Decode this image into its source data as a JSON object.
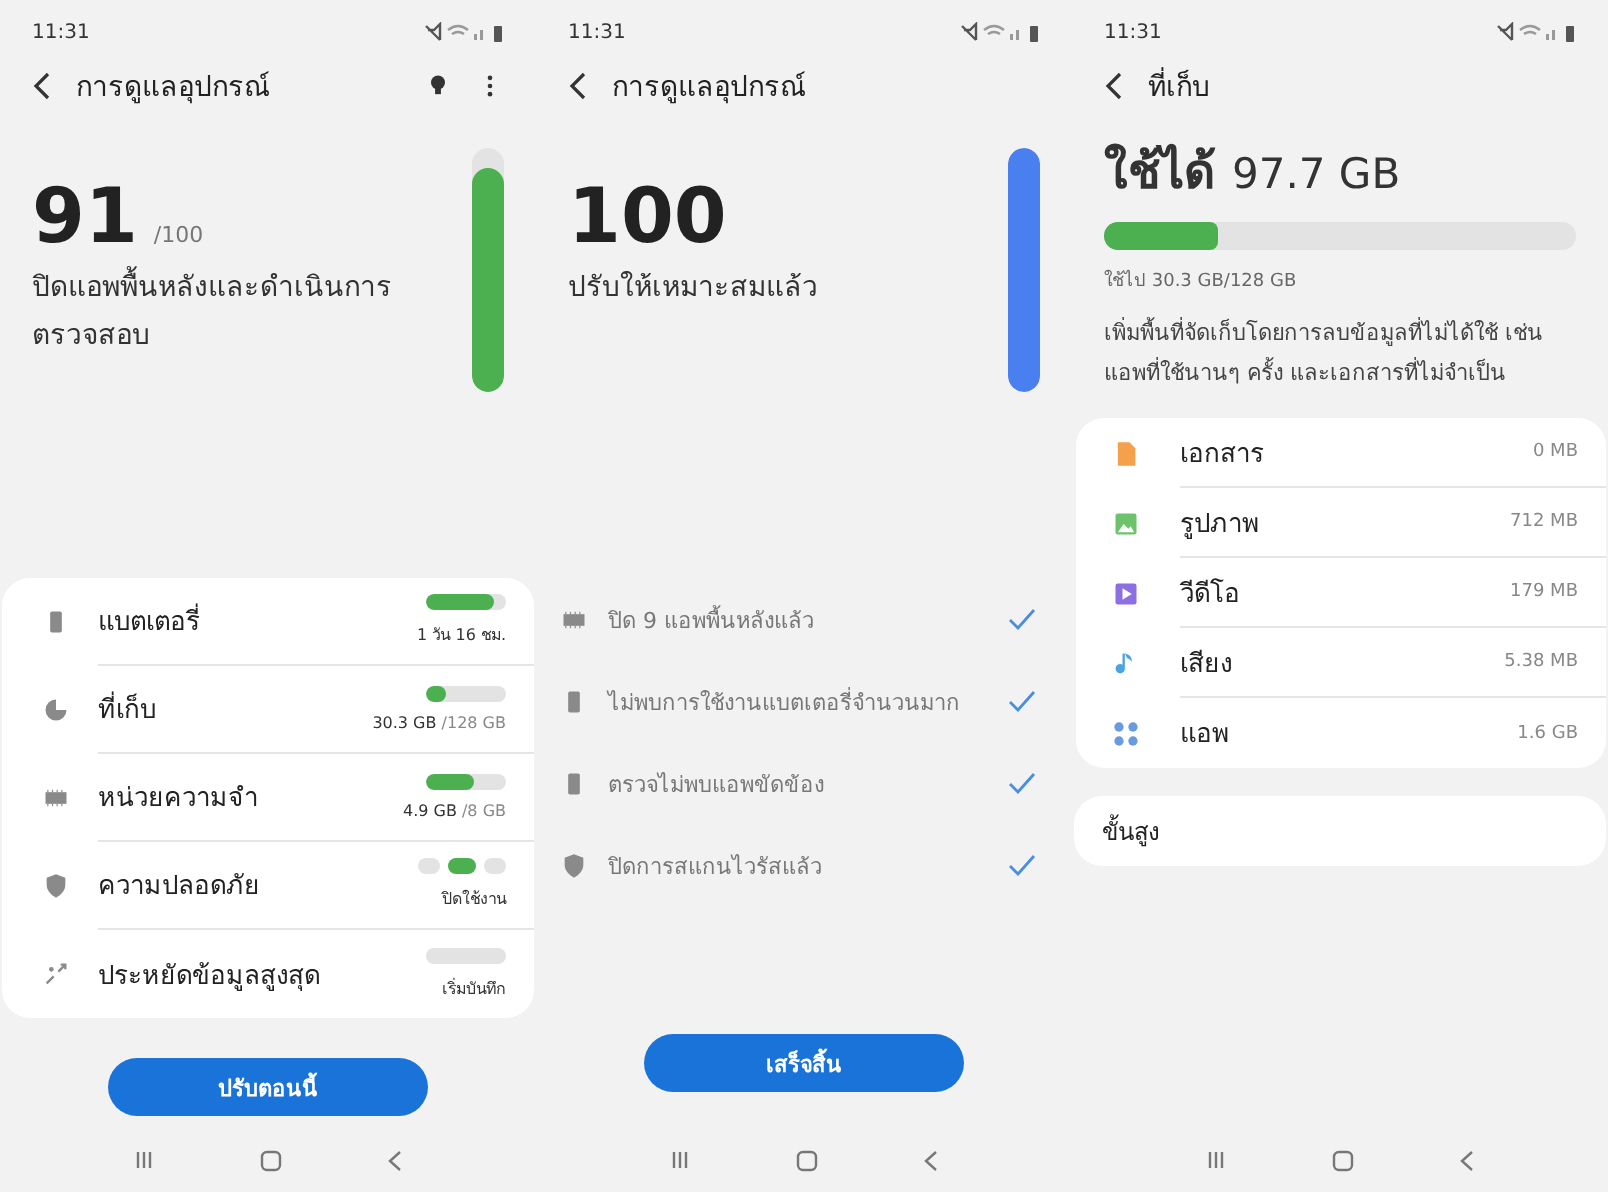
{
  "care_screen": {
    "status_bar": {
      "time": "11:31"
    },
    "title": "การดูแลอุปกรณ์",
    "score": "91",
    "score_max": "/100",
    "message": "ปิดแอพพื้นหลังและดำเนินการตรวจสอบ",
    "meter": {
      "level": 0.92,
      "color": "#4caf50"
    },
    "items": [
      {
        "kind": "bar",
        "name": "แบตเตอรี่",
        "reading": "1 วัน 16 ชม.",
        "level": 0.85
      },
      {
        "kind": "bar",
        "name": "ที่เก็บ",
        "reading": "30.3 GB",
        "reading_total": "/128 GB",
        "level": 0.24
      },
      {
        "kind": "bar",
        "name": "หน่วยความจำ",
        "reading": "4.9 GB",
        "reading_total": "/8 GB",
        "level": 0.61
      },
      {
        "kind": "dots",
        "name": "ความปลอดภัย",
        "reading": "ปิดใช้งาน",
        "dots": [
          {
            "selected": false
          },
          {
            "selected": true
          },
          {
            "selected": false
          }
        ]
      },
      {
        "kind": "empty_bar",
        "name": "ประหยัดข้อมูลสูงสุด",
        "reading": "เริ่มบันทึก"
      }
    ],
    "button": "ปรับตอนนี้"
  },
  "done_screen": {
    "status_bar": {
      "time": "11:31"
    },
    "title": "การดูแลอุปกรณ์",
    "score": "100",
    "message": "ปรับให้เหมาะสมแล้ว",
    "meter": {
      "level": 1,
      "color": "#4a7fef"
    },
    "results": [
      {
        "text": "ปิด 9 แอพพื้นหลังแล้ว",
        "checked": true
      },
      {
        "text": "ไม่พบการใช้งานแบตเตอรี่จำนวนมาก",
        "checked": true
      },
      {
        "text": "ตรวจไม่พบแอพขัดข้อง",
        "checked": true
      },
      {
        "text": "ปิดการสแกนไวรัสแล้ว",
        "checked": true
      }
    ],
    "button": "เสร็จสิ้น"
  },
  "storage_screen": {
    "status_bar": {
      "time": "11:31"
    },
    "title": "ที่เก็บ",
    "available_label": "ใช้ได้",
    "available": "97.7 GB",
    "usage": {
      "level": 0.24
    },
    "used": "ใช้ไป 30.3 GB/128 GB",
    "description": "เพิ่มพื้นที่จัดเก็บโดยการลบข้อมูลที่ไม่ได้ใช้ เช่น แอพที่ใช้นานๆ ครั้ง และเอกสารที่ไม่จำเป็น",
    "categories": [
      {
        "name": "เอกสาร",
        "size": "0 MB",
        "color": "#f5a04a"
      },
      {
        "name": "รูปภาพ",
        "size": "712 MB",
        "color": "#6cc36c"
      },
      {
        "name": "วีดีโอ",
        "size": "179 MB",
        "color": "#8c6fe0"
      },
      {
        "name": "เสียง",
        "size": "5.38 MB",
        "color": "#4ba3e0"
      },
      {
        "name": "แอพ",
        "size": "1.6 GB",
        "color": "#6a9be0"
      }
    ],
    "advanced": "ขั้นสูง"
  }
}
